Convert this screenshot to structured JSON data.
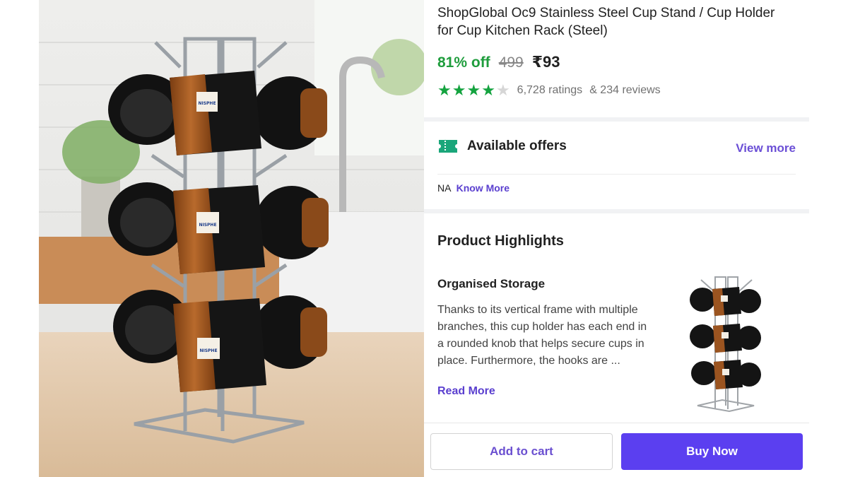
{
  "product": {
    "title": "ShopGlobal Oc9 Stainless Steel Cup Stand / Cup Holder for Cup Kitchen Rack (Steel)",
    "discount": "81% off",
    "mrp": "499",
    "price": "₹93",
    "rating_value": 4,
    "rating_max": 5,
    "ratings_text": "6,728 ratings",
    "reviews_text": "& 234 reviews",
    "image_alt": "Stainless steel cup stand holding six black and brown mugs",
    "mug_label": "NISPHE"
  },
  "offers": {
    "icon": "ticket-icon",
    "title": "Available offers",
    "view_more": "View more",
    "text": "NA",
    "link": "Know More"
  },
  "highlights": {
    "title": "Product Highlights",
    "subtitle": "Organised Storage",
    "text": "Thanks to its vertical frame with multiple branches, this cup holder has each end in a rounded knob that helps secure cups in place. Furthermore, the hooks are ...",
    "read_more": "Read More"
  },
  "actions": {
    "add_to_cart": "Add to cart",
    "buy_now": "Buy Now"
  },
  "colors": {
    "discount_green": "#1f9d3d",
    "star_green": "#14a33f",
    "accent_purple": "#5b3ff0",
    "link_purple": "#5a3fcf"
  }
}
